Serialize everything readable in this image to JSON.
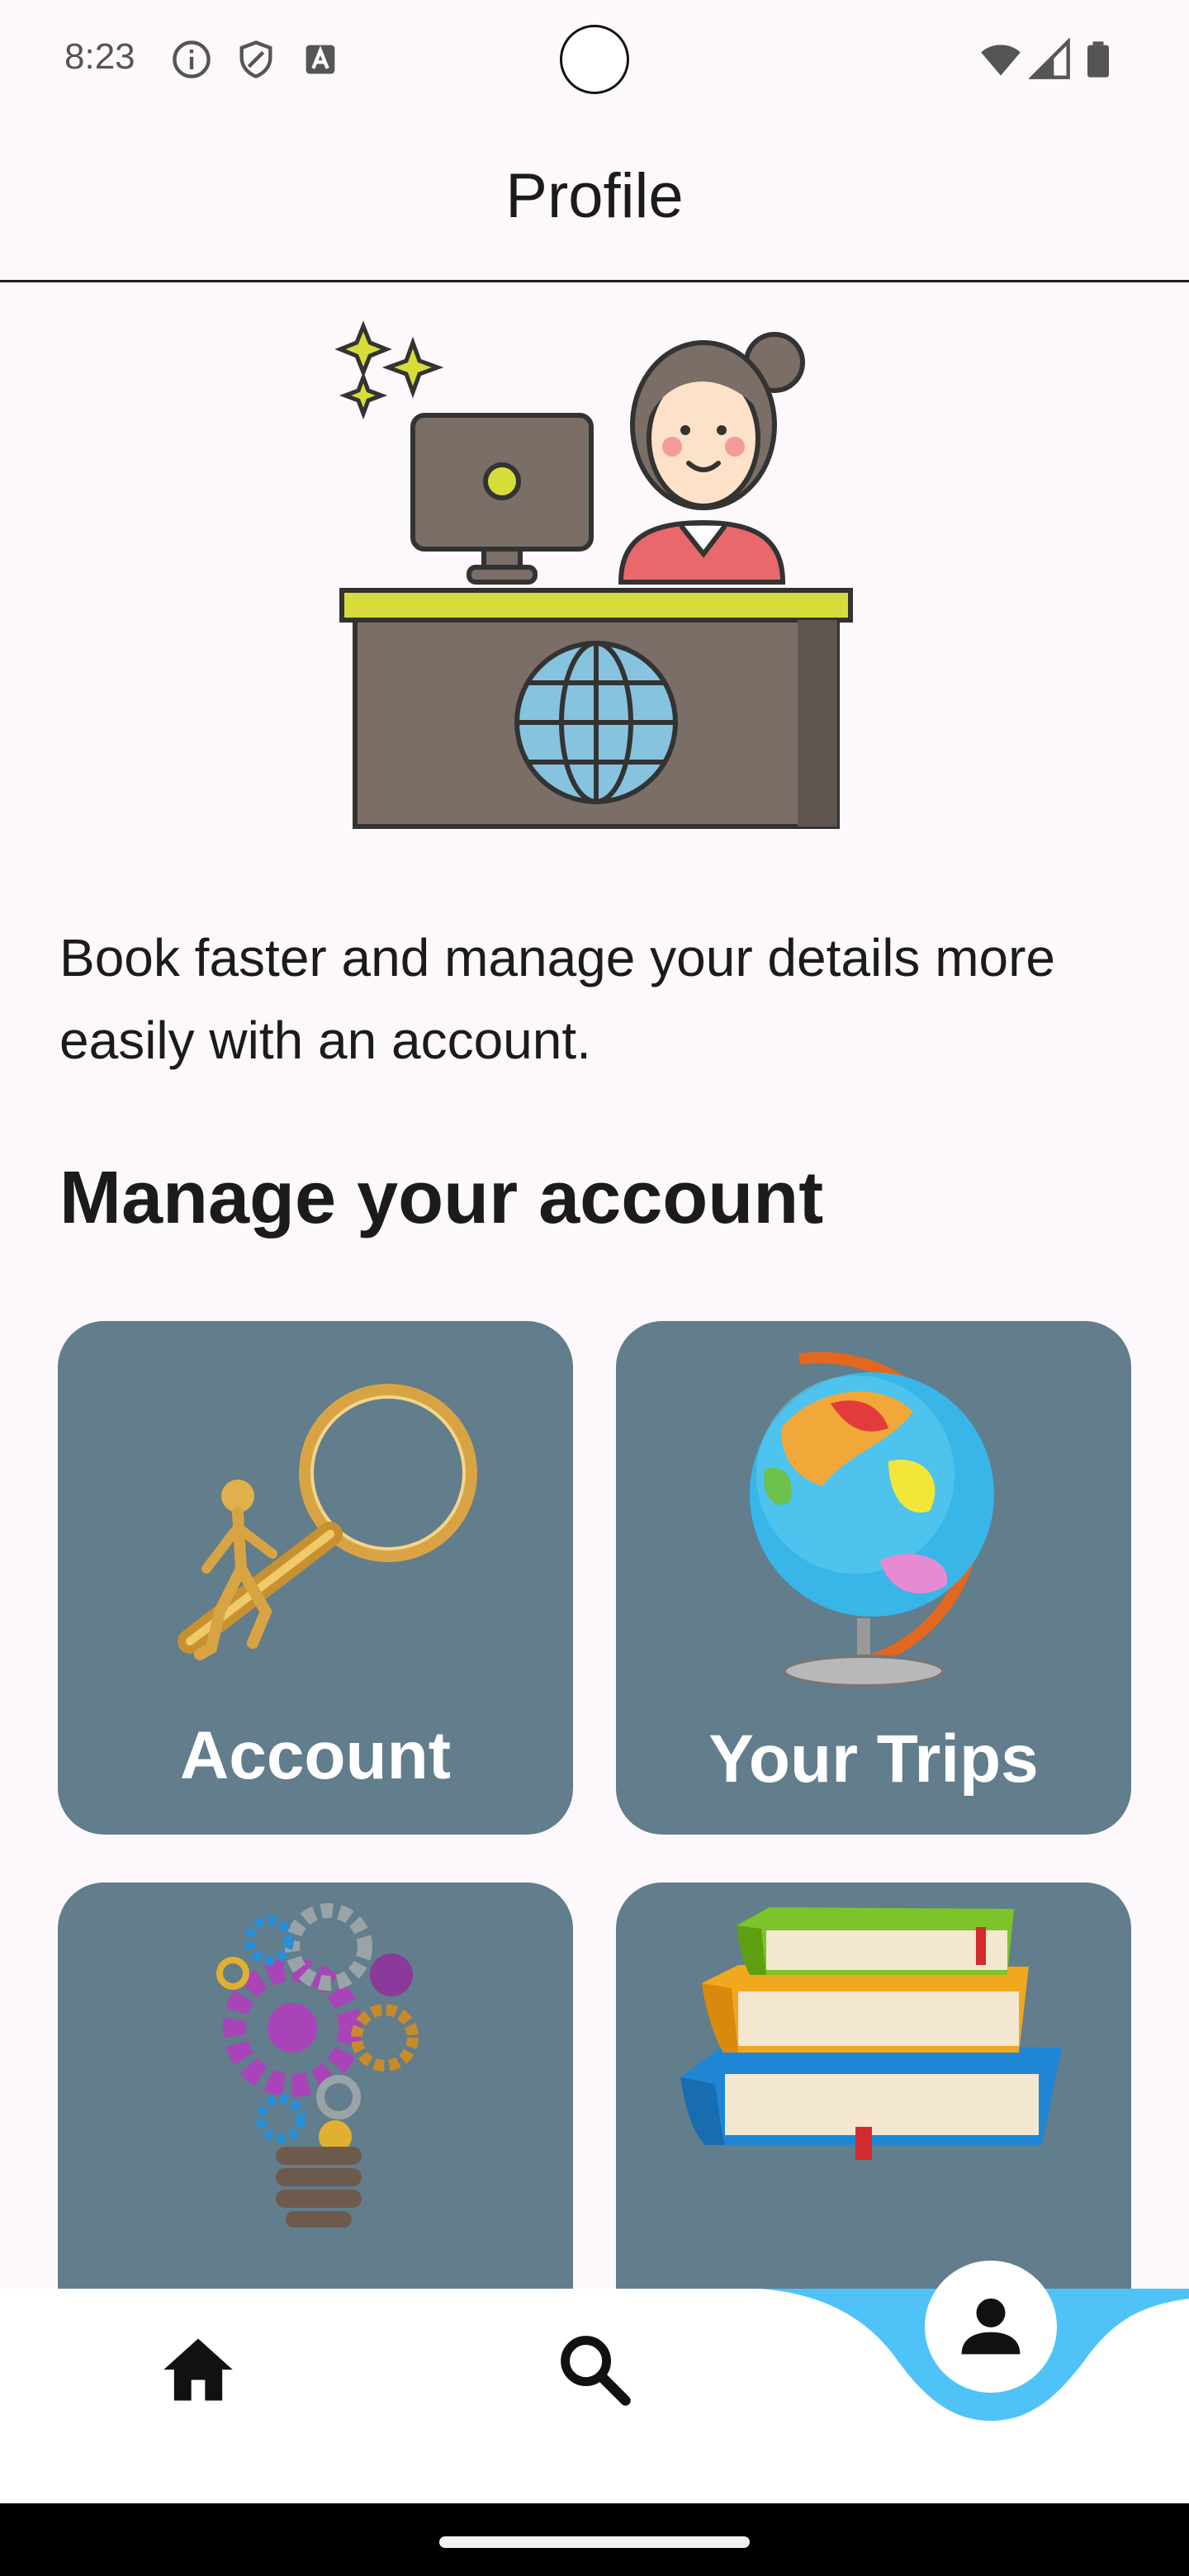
{
  "status_bar": {
    "time": "8:23",
    "icons": [
      "info-icon",
      "shield-icon",
      "text-a-icon",
      "wifi-icon",
      "signal-icon",
      "battery-icon"
    ]
  },
  "app_bar": {
    "title": "Profile"
  },
  "hero": {
    "image": "travel-agent-desk-illustration"
  },
  "intro": {
    "text": "Book faster and manage your details more easily with an account."
  },
  "section": {
    "title": "Manage your account"
  },
  "tiles": [
    {
      "label": "Account",
      "icon": "magnifier-figure-icon"
    },
    {
      "label": "Your Trips",
      "icon": "globe-icon"
    },
    {
      "label": "",
      "icon": "gear-lightbulb-icon"
    },
    {
      "label": "",
      "icon": "books-icon"
    }
  ],
  "bottom_nav": {
    "items": [
      {
        "name": "home",
        "icon": "home-icon"
      },
      {
        "name": "search",
        "icon": "search-icon"
      },
      {
        "name": "profile",
        "icon": "person-icon",
        "selected": true
      }
    ]
  },
  "colors": {
    "background": "#fdf8fb",
    "tile": "#627d8c",
    "accent": "#4fc3f7"
  }
}
